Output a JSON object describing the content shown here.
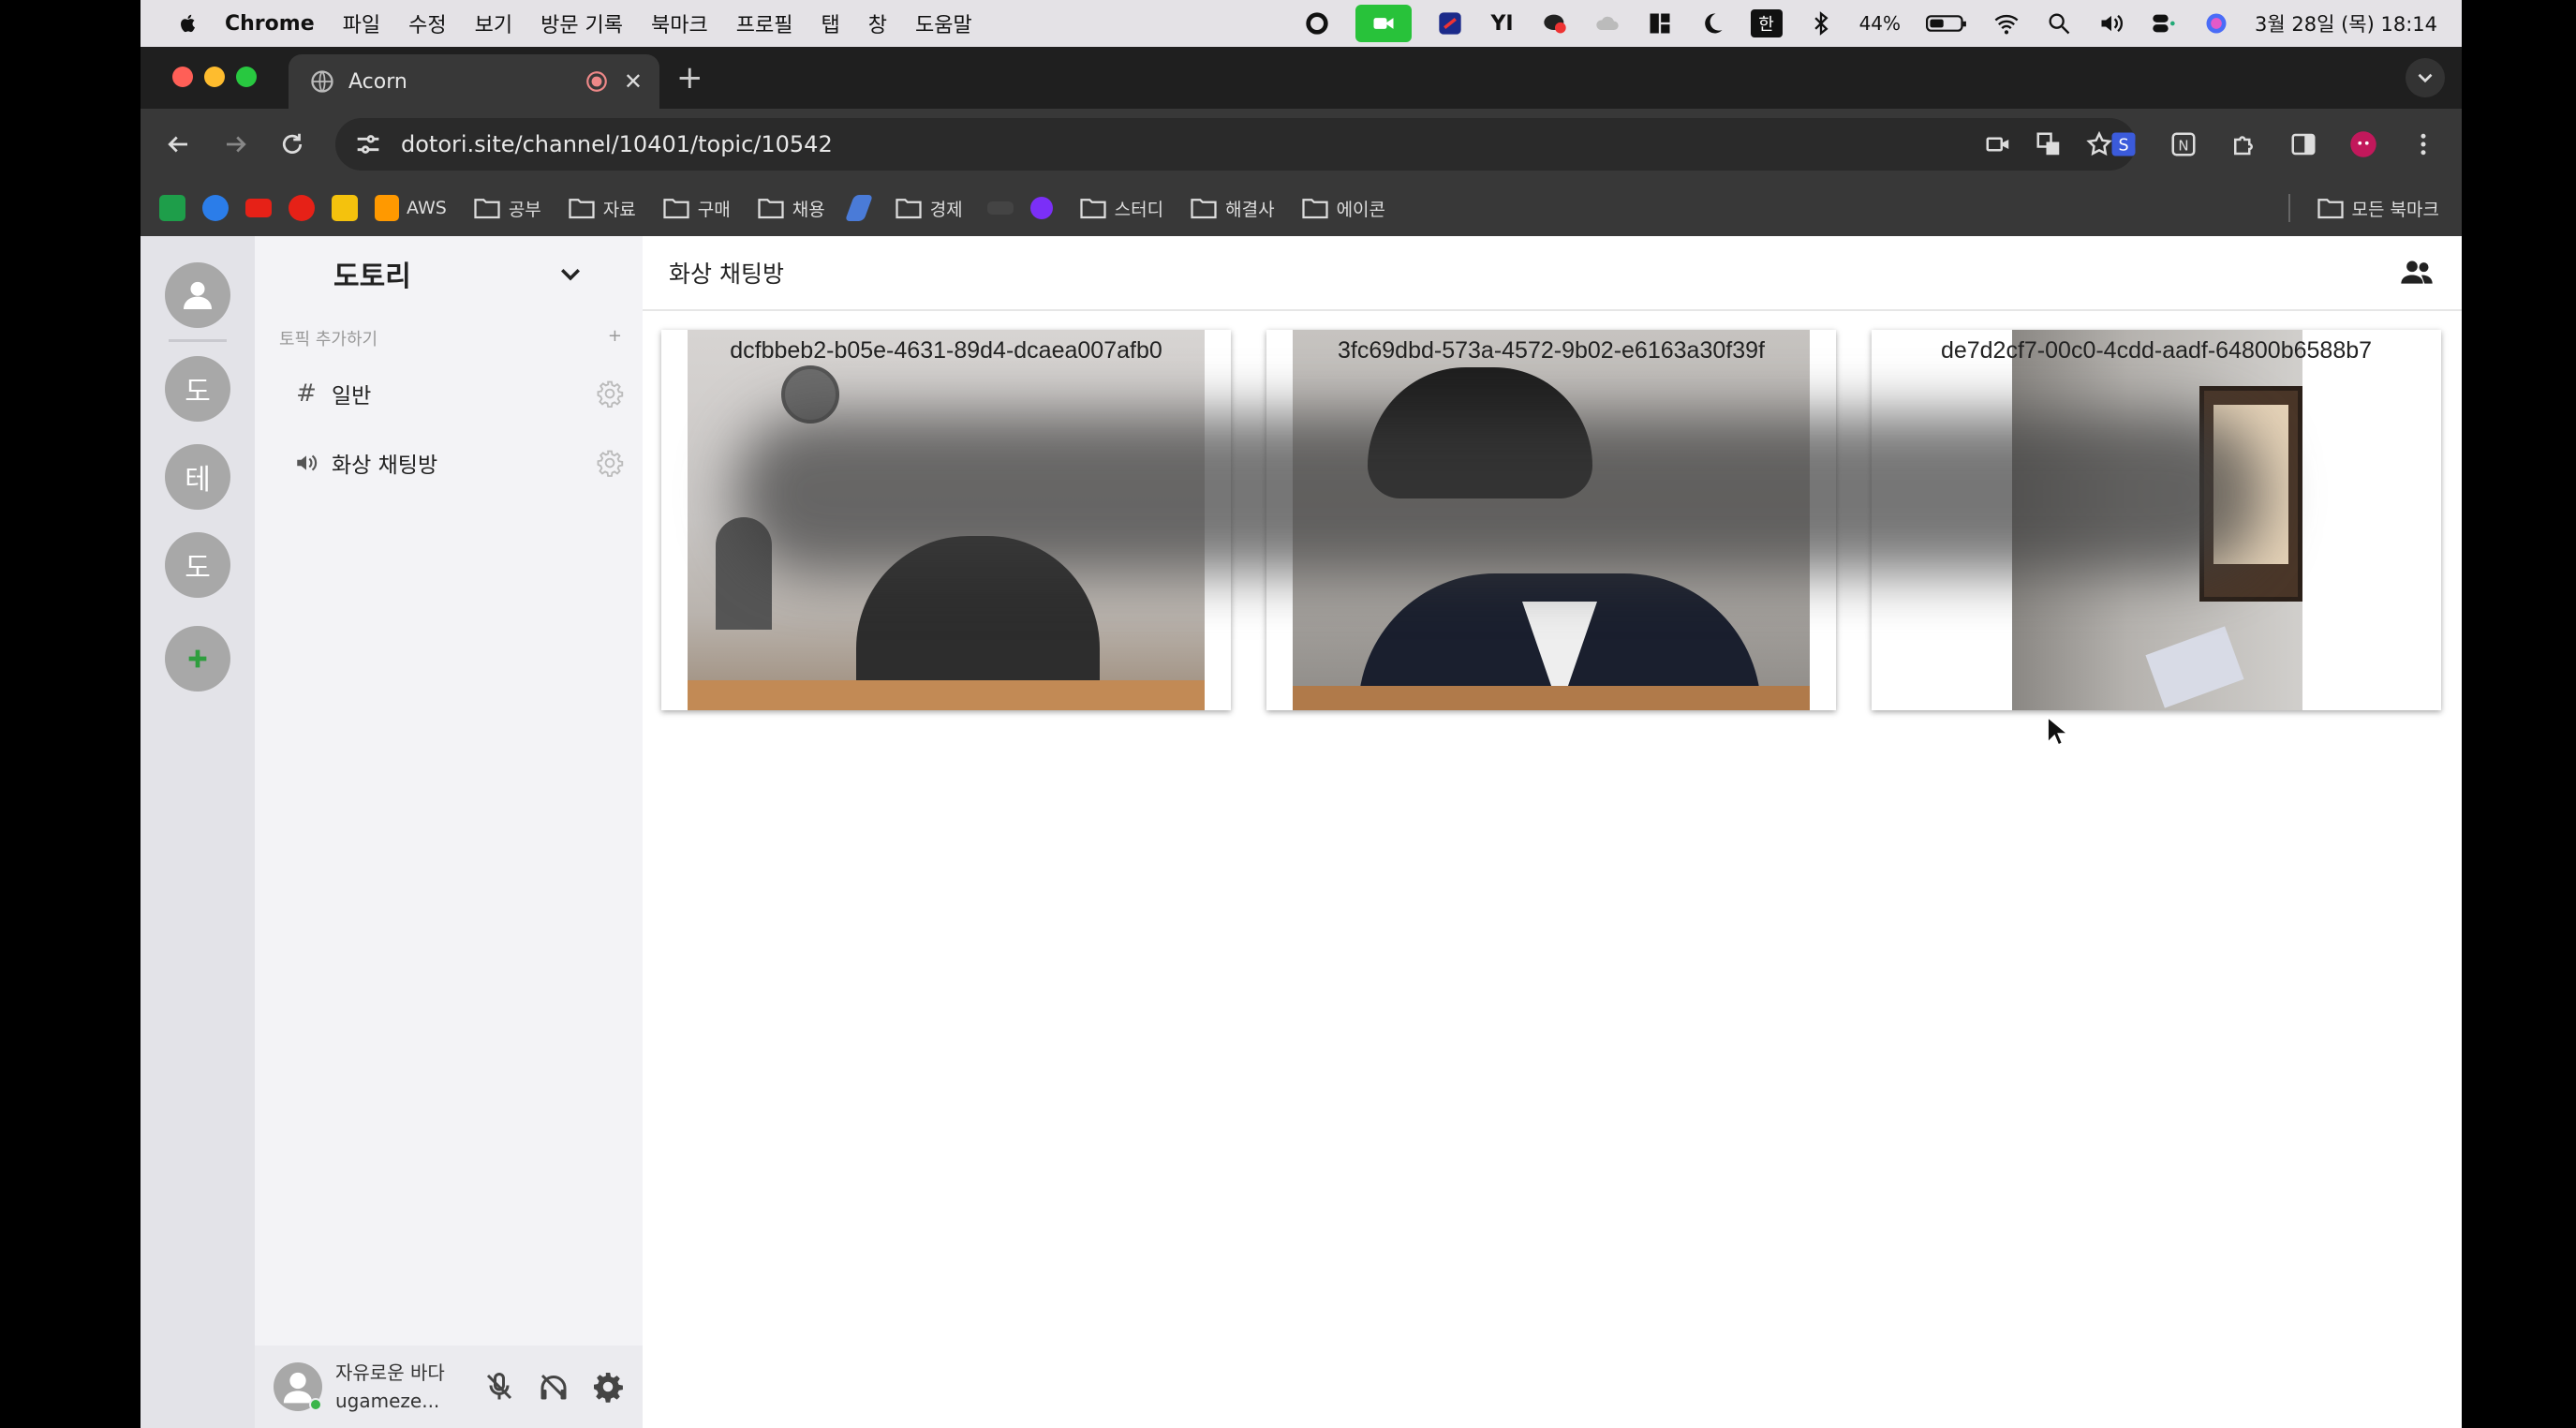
{
  "menubar": {
    "items": [
      "Chrome",
      "파일",
      "수정",
      "보기",
      "방문 기록",
      "북마크",
      "프로필",
      "탭",
      "창",
      "도움말"
    ],
    "battery": "44%",
    "clock": "3월 28일 (목) 18:14",
    "ime": "한"
  },
  "tab": {
    "title": "Acorn"
  },
  "address": {
    "url": "dotori.site/channel/10401/topic/10542"
  },
  "bookmarks": {
    "items": [
      "AWS",
      "공부",
      "자료",
      "구매",
      "채용",
      "경제",
      "스터디",
      "해결사",
      "에이콘"
    ],
    "all_bookmarks": "모든 북마크"
  },
  "servers": [
    "도",
    "테",
    "도"
  ],
  "channel_panel": {
    "server_name": "도토리",
    "add_topic": "토픽 추가하기",
    "add_topic_plus": "+",
    "topics": [
      {
        "icon": "hash-icon",
        "label": "일반"
      },
      {
        "icon": "speaker-icon",
        "label": "화상 채팅방"
      }
    ]
  },
  "user": {
    "display_name": "자유로운 바다",
    "username": "ugameze..."
  },
  "main": {
    "title": "화상 채팅방",
    "videos": [
      {
        "id": "dcfbbeb2-b05e-4631-89d4-dcaea007afb0"
      },
      {
        "id": "3fc69dbd-573a-4572-9b02-e6163a30f39f"
      },
      {
        "id": "de7d2cf7-00c0-4cdd-aadf-64800b6588b7"
      }
    ]
  },
  "colors": {
    "add_server_green": "#2e9e3e",
    "online": "#3bb54a"
  }
}
